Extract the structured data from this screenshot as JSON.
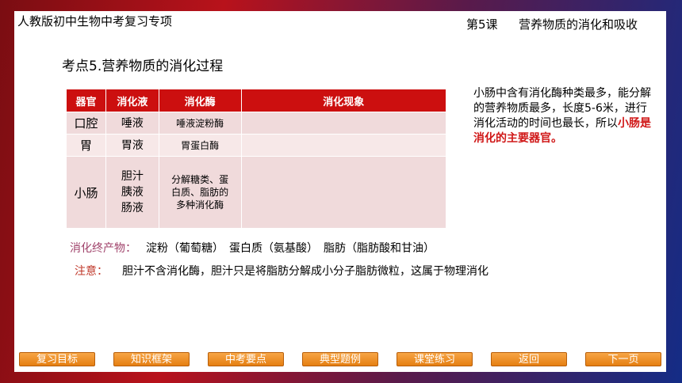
{
  "header": {
    "course": "人教版初中生物中考复习专项",
    "lesson": "第5课",
    "topic": "营养物质的消化和吸收"
  },
  "point_title": "考点5.营养物质的消化过程",
  "table": {
    "headers": [
      "器官",
      "消化液",
      "消化酶",
      "消化现象"
    ],
    "rows": [
      {
        "organ": "口腔",
        "juice": "唾液",
        "enzyme": "唾液淀粉酶",
        "phenomenon": ""
      },
      {
        "organ": "胃",
        "juice": "胃液",
        "enzyme": "胃蛋白酶",
        "phenomenon": ""
      },
      {
        "organ": "小肠",
        "juice_lines": [
          "胆汁",
          "胰液",
          "肠液"
        ],
        "enzyme_lines": [
          "分解糖类、蛋",
          "白质、脂肪的",
          "多种消化酶"
        ],
        "phenomenon": ""
      }
    ]
  },
  "side_note": {
    "text": "小肠中含有消化酶种类最多，能分解的营养物质最多，长度5-6米，进行消化活动的时间也最长，所以",
    "highlight": "小肠是消化的主要器官。"
  },
  "end_products": {
    "label": "消化终产物：",
    "value": "淀粉（葡萄糖）　蛋白质（氨基酸）　脂肪（脂肪酸和甘油）"
  },
  "note": {
    "label": "注意：",
    "value": "胆汁不含消化酶，胆汁只是将脂肪分解成小分子脂肪微粒，这属于物理消化"
  },
  "nav": [
    "复习目标",
    "知识框架",
    "中考要点",
    "典型题例",
    "课堂练习",
    "返回",
    "下一页"
  ]
}
